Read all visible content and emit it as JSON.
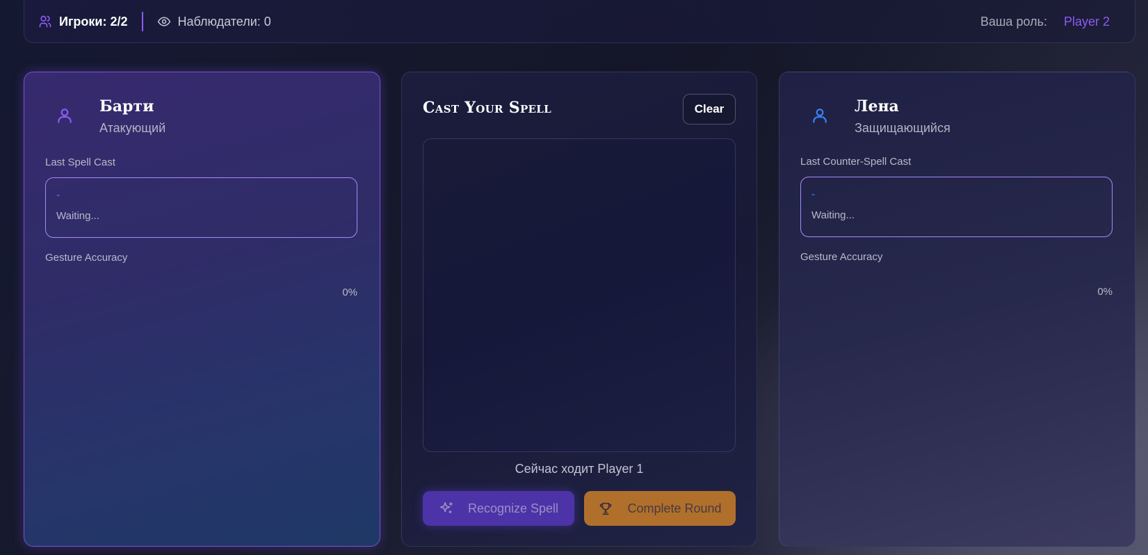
{
  "topbar": {
    "players_label": "Игроки: 2/2",
    "watchers_label": "Наблюдатели: 0",
    "role_label": "Ваша роль:",
    "role_value": "Player 2"
  },
  "left_player": {
    "name": "Барти",
    "role": "Атакующий",
    "last_cast_label": "Last Spell Cast",
    "last_cast_value": "-",
    "status": "Waiting...",
    "accuracy_label": "Gesture Accuracy",
    "accuracy_value": "0%"
  },
  "center": {
    "title": "Cast Your Spell",
    "clear_label": "Clear",
    "turn_text": "Сейчас ходит Player 1",
    "recognize_label": "Recognize Spell",
    "complete_label": "Complete Round"
  },
  "right_player": {
    "name": "Лена",
    "role": "Защищающийся",
    "last_cast_label": "Last Counter-Spell Cast",
    "last_cast_value": "-",
    "status": "Waiting...",
    "accuracy_label": "Gesture Accuracy",
    "accuracy_value": "0%"
  },
  "icons": {
    "players": "users-icon",
    "watchers": "eye-icon",
    "attacker": "user-icon",
    "defender": "user-icon",
    "recognize": "sparkles-icon",
    "complete": "trophy-icon"
  },
  "colors": {
    "accent_purple": "#8b5cf6",
    "accent_blue": "#3b82f6",
    "orange": "#b0702c"
  }
}
